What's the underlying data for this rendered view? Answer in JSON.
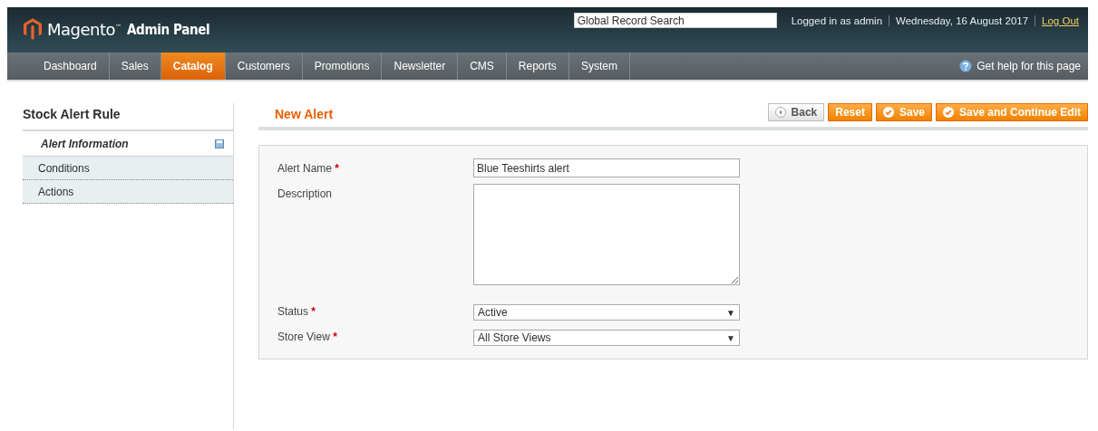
{
  "header": {
    "logo_text": "Magento$^{™}$",
    "logo_subtitle": "Admin Panel",
    "search": {
      "placeholder": "Global Record Search"
    },
    "user_info": "Logged in as admin",
    "date": "Wednesday, 16 August 2017",
    "logout": "Log Out"
  },
  "nav": {
    "items": [
      {
        "label": "Dashboard",
        "selected": false
      },
      {
        "label": "Sales",
        "selected": false
      },
      {
        "label": "Catalog",
        "selected": true
      },
      {
        "label": "Customers",
        "selected": false
      },
      {
        "label": "Promotions",
        "selected": false
      },
      {
        "label": "Newsletter",
        "selected": false
      },
      {
        "label": "CMS",
        "selected": false
      },
      {
        "label": "Reports",
        "selected": false
      },
      {
        "label": "System",
        "selected": false
      }
    ],
    "help": "Get help for this page"
  },
  "sidebar": {
    "title": "Stock Alert Rule",
    "tabs": [
      {
        "label": "Alert Information",
        "selected": true
      },
      {
        "label": "Conditions",
        "selected": false
      },
      {
        "label": "Actions",
        "selected": false
      }
    ]
  },
  "page": {
    "title": "New Alert",
    "buttons": [
      {
        "label": "Back",
        "kind": "back"
      },
      {
        "label": "Reset",
        "kind": "plain"
      },
      {
        "label": "Save",
        "kind": "check"
      },
      {
        "label": "Save and Continue Edit",
        "kind": "check"
      }
    ]
  },
  "form": {
    "fields": [
      {
        "label": "Alert Name",
        "required_mark": "*",
        "kind": "text",
        "value": "Blue Teeshirts alert"
      },
      {
        "label": "Description",
        "kind": "textarea"
      },
      {
        "label": "Status",
        "required_mark": "*",
        "kind": "select",
        "value": "Active",
        "arrow": "▼"
      },
      {
        "label": "Store View",
        "required_mark": "*",
        "kind": "select",
        "value": "All Store Views",
        "arrow": "▼"
      }
    ]
  }
}
